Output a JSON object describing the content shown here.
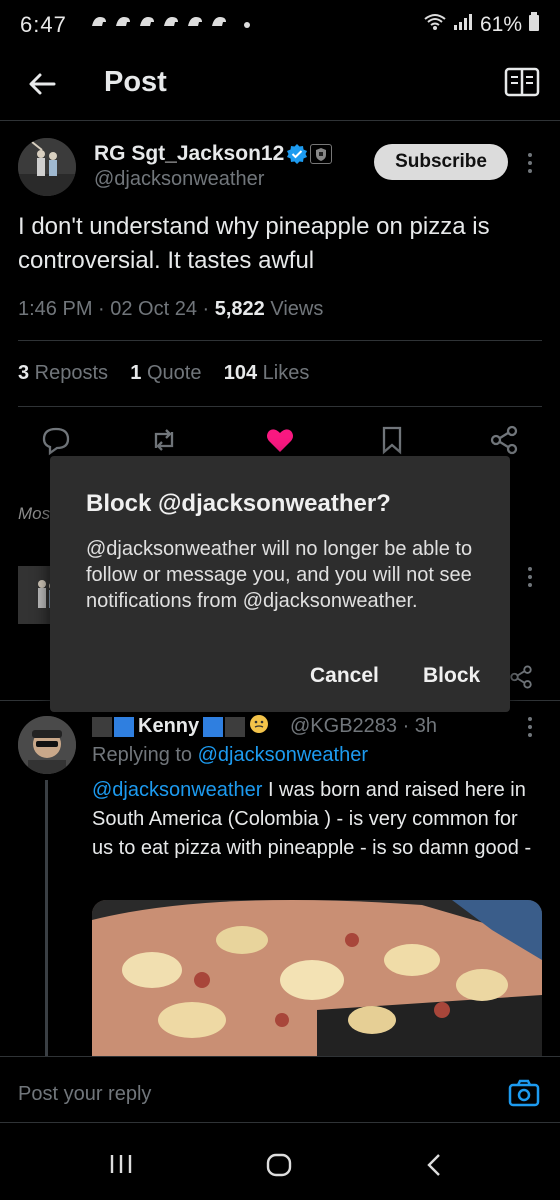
{
  "status_bar": {
    "time": "6:47",
    "battery": "61%"
  },
  "header": {
    "title": "Post"
  },
  "author": {
    "name": "RG Sgt_Jackson12",
    "handle": "@djacksonweather",
    "subscribe_label": "Subscribe"
  },
  "post": {
    "text": "I don't understand why pineapple on pizza is controversial. It tastes awful",
    "time": "1:46 PM · 02 Oct 24 · ",
    "views_count": "5,822",
    "views_label": " Views"
  },
  "stats": {
    "reposts_count": "3",
    "reposts_label": " Reposts",
    "quotes_count": "1",
    "quotes_label": " Quote",
    "likes_count": "104",
    "likes_label": " Likes"
  },
  "actions": {
    "liked": true,
    "like_color": "#f91880"
  },
  "section_label": "Mos",
  "modal": {
    "title": "Block @djacksonweather?",
    "body": "@djacksonweather will no longer be able to follow or message you, and you will not see notifications from @djacksonweather.",
    "cancel_label": "Cancel",
    "block_label": "Block"
  },
  "reply": {
    "name": "Kenny",
    "handle_time": "@KGB2283 · 3h",
    "replying_prefix": "Replying to ",
    "replying_handle": "@djacksonweather",
    "mention": "@djacksonweather",
    "text": " I was born and raised here in South America (Colombia ) - is very common for us to eat pizza with pineapple - is so damn good -"
  },
  "composer": {
    "placeholder": "Post your reply"
  },
  "colors": {
    "accent": "#1d9bf0",
    "background": "#000000",
    "modal": "#2d2d2d"
  }
}
